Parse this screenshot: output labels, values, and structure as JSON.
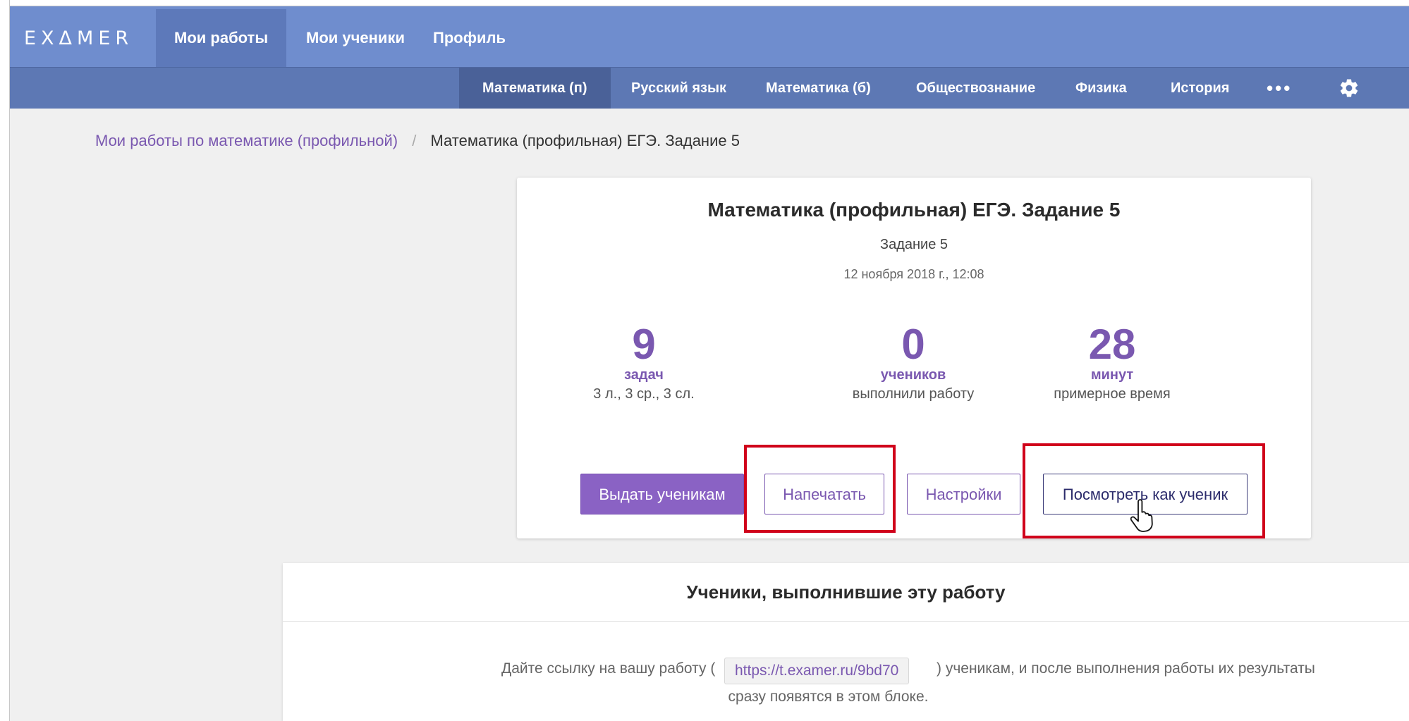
{
  "app": {
    "logo": "EXΔMER"
  },
  "topnav": {
    "items": [
      {
        "label": "Мои работы",
        "active": true
      },
      {
        "label": "Мои ученики",
        "active": false
      },
      {
        "label": "Профиль",
        "active": false
      }
    ]
  },
  "subnav": {
    "items": [
      {
        "label": "Математика (п)",
        "active": true
      },
      {
        "label": "Русский язык",
        "active": false
      },
      {
        "label": "Математика (б)",
        "active": false
      },
      {
        "label": "Обществознание",
        "active": false
      },
      {
        "label": "Физика",
        "active": false
      },
      {
        "label": "История",
        "active": false
      }
    ],
    "more": "•••",
    "settings_icon": "gear-icon"
  },
  "breadcrumb": {
    "parent": "Мои работы по математике (профильной)",
    "separator": "/",
    "current": "Математика (профильная) ЕГЭ. Задание 5"
  },
  "card": {
    "title": "Математика (профильная) ЕГЭ. Задание 5",
    "subtitle": "Задание 5",
    "date": "12 ноября 2018 г., 12:08",
    "stats": [
      {
        "value": "9",
        "unit": "задач",
        "desc": "3 л., 3 ср., 3 сл."
      },
      {
        "value": "0",
        "unit": "учеников",
        "desc": "выполнили работу"
      },
      {
        "value": "28",
        "unit": "минут",
        "desc": "примерное время"
      }
    ],
    "buttons": {
      "assign": "Выдать ученикам",
      "print": "Напечатать",
      "settings": "Настройки",
      "view_as_student": "Посмотреть как ученик"
    }
  },
  "students": {
    "title": "Ученики, выполнившие эту работу",
    "text_before": "Дайте ссылку на вашу работу (",
    "link": "https://t.examer.ru/9bd70",
    "text_after": ") ученикам, и после выполнения работы их результаты",
    "text_line2": "сразу появятся в этом блоке."
  },
  "colors": {
    "nav": "#6f8dce",
    "subnav": "#5d78b4",
    "accent": "#7a58b0",
    "primary_button": "#8a62c4",
    "highlight": "#d0021b"
  }
}
